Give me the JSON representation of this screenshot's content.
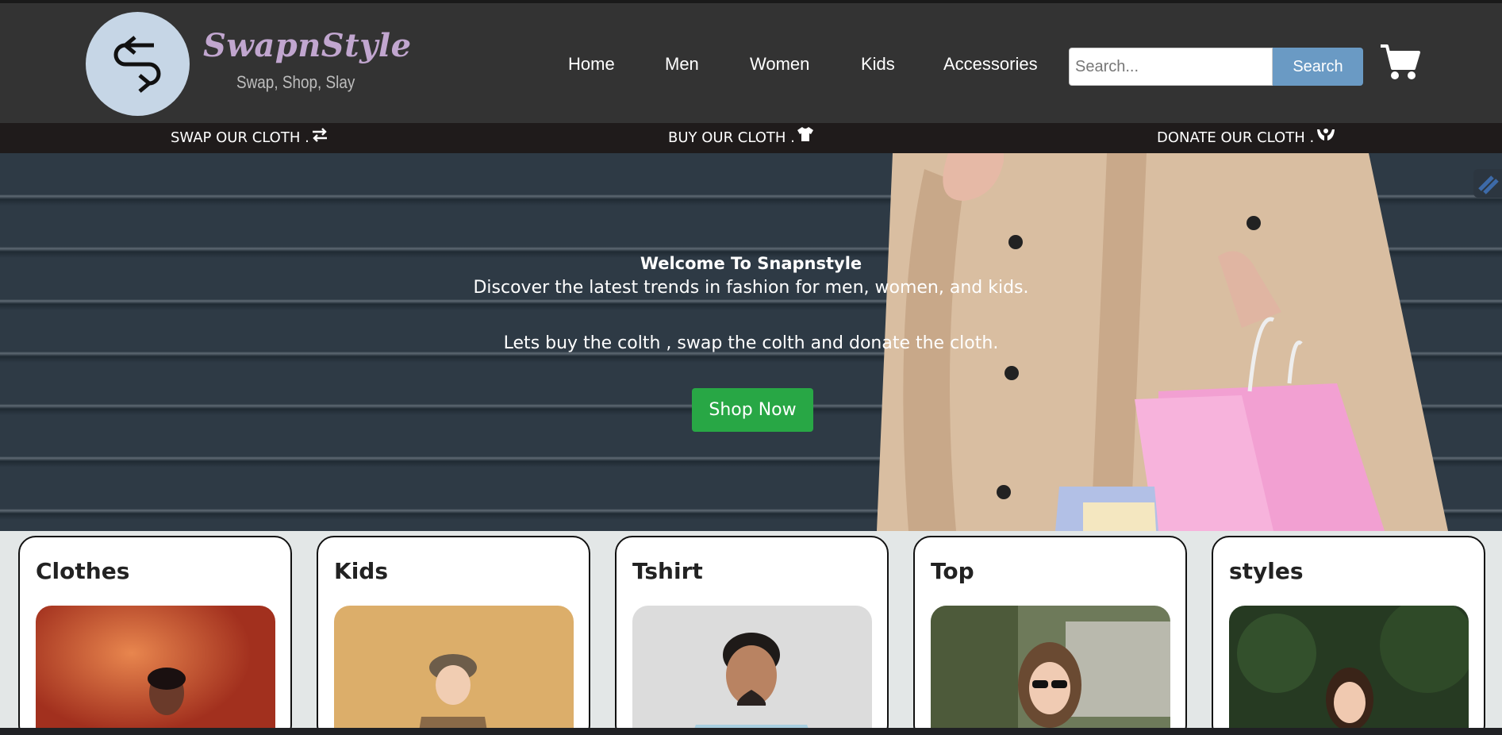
{
  "brand": {
    "name": "SwapnStyle",
    "tagline": "Swap, Shop, Slay",
    "logo_icon": "swap-arrows-icon"
  },
  "nav": {
    "items": [
      "Home",
      "Men",
      "Women",
      "Kids",
      "Accessories"
    ]
  },
  "search": {
    "placeholder": "Search...",
    "button_label": "Search"
  },
  "cart": {
    "icon": "cart-icon"
  },
  "subbar": {
    "items": [
      {
        "label": "SWAP OUR CLOTH .",
        "icon": "swap-icon"
      },
      {
        "label": "BUY OUR CLOTH .",
        "icon": "tshirt-icon"
      },
      {
        "label": "DONATE OUR CLOTH .",
        "icon": "hands-icon"
      }
    ]
  },
  "hero": {
    "title": "Welcome To Snapnstyle",
    "subtitle": "Discover the latest trends in fashion for men, women, and kids.",
    "subtitle2": "Lets buy the colth , swap the colth and donate the cloth.",
    "cta_label": "Shop Now"
  },
  "categories": [
    {
      "title": "Clothes"
    },
    {
      "title": "Kids"
    },
    {
      "title": "Tshirt"
    },
    {
      "title": "Top"
    },
    {
      "title": "styles"
    }
  ],
  "colors": {
    "header_bg": "#333333",
    "subbar_bg": "#1f1b1b",
    "search_button": "#6a9ac4",
    "cta": "#28a745",
    "brand": "#c1a6cf"
  }
}
